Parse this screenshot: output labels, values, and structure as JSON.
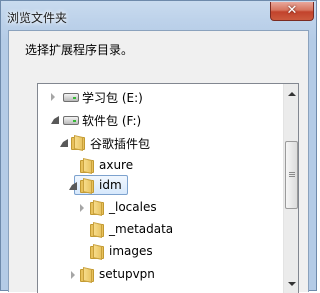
{
  "window": {
    "title": "浏览文件夹",
    "close_label": "✕",
    "prompt": "选择扩展程序目录。"
  },
  "tree": {
    "items": [
      {
        "label": "学习包 (E:)",
        "icon": "drive-icon",
        "expander": "collapsed"
      },
      {
        "label": "软件包 (F:)",
        "icon": "drive-icon",
        "expander": "expanded"
      },
      {
        "label": "谷歌插件包",
        "icon": "folder-icon",
        "expander": "expanded"
      },
      {
        "label": "axure",
        "icon": "folder-icon",
        "expander": "none"
      },
      {
        "label": "idm",
        "icon": "folder-icon",
        "expander": "expanded",
        "selected": true
      },
      {
        "label": "_locales",
        "icon": "folder-icon",
        "expander": "collapsed"
      },
      {
        "label": "_metadata",
        "icon": "folder-icon",
        "expander": "none"
      },
      {
        "label": "images",
        "icon": "folder-icon",
        "expander": "none"
      },
      {
        "label": "setupvpn",
        "icon": "folder-icon",
        "expander": "collapsed"
      }
    ]
  },
  "colors": {
    "selection_border": "#7da2ce",
    "folder": "#e8c15c",
    "close_button": "#c2432c"
  }
}
